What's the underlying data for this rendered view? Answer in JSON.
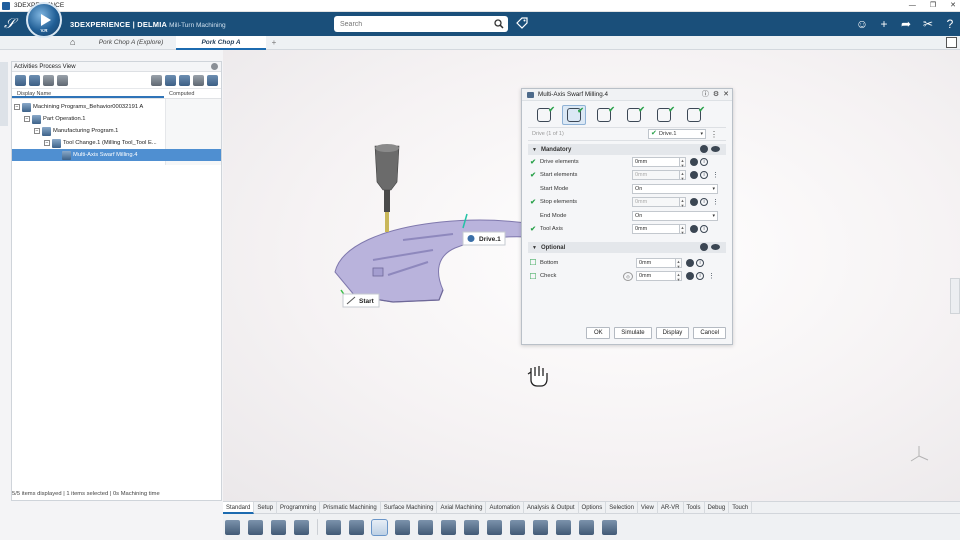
{
  "window": {
    "title": "3DEXPERIENCE",
    "controls": [
      "—",
      "❐",
      "✕"
    ]
  },
  "header": {
    "brand": "3DEXPERIENCE | DELMIA",
    "app": "Mill-Turn Machining",
    "compass_version": "V.R",
    "search_placeholder": "Search",
    "icons": [
      "user-icon",
      "add-icon",
      "share-icon",
      "tools-icon",
      "help-icon"
    ]
  },
  "tabs": [
    {
      "label": "Pork Chop A (Explore)",
      "active": false
    },
    {
      "label": "Pork Chop A",
      "active": true
    }
  ],
  "panel": {
    "title": "Activities Process View",
    "columns": [
      "Display Name",
      "Computed"
    ],
    "tree": [
      {
        "label": "Machining Programs_Behavior00032191 A",
        "level": 0
      },
      {
        "label": "Part Operation.1",
        "level": 1
      },
      {
        "label": "Manufacturing Program.1",
        "level": 2
      },
      {
        "label": "Tool Change.1 (Milling Tool_Tool E...",
        "level": 3
      },
      {
        "label": "Multi-Axis Swarf Milling.4",
        "level": 4,
        "selected": true
      }
    ],
    "status": "5/5 items displayed | 1 items selected | 0s Machining time"
  },
  "viewport": {
    "labels": {
      "drive": "Drive.1",
      "start": "Start"
    }
  },
  "dialog": {
    "title": "Multi-Axis Swarf Milling.4",
    "selector": {
      "label": "Drive (1 of 1)",
      "value": "Drive.1"
    },
    "mandatory": {
      "title": "Mandatory",
      "rows": [
        {
          "label": "Drive elements",
          "value": "0mm",
          "status": "ok",
          "disabled": false
        },
        {
          "label": "Start elements",
          "value": "0mm",
          "status": "ok",
          "disabled": true
        },
        {
          "label": "Start Mode",
          "value": "On",
          "type": "select"
        },
        {
          "label": "Stop elements",
          "value": "0mm",
          "status": "ok",
          "disabled": true
        },
        {
          "label": "End Mode",
          "value": "On",
          "type": "select"
        },
        {
          "label": "Tool Axis",
          "value": "0mm",
          "status": "ok",
          "disabled": false
        }
      ]
    },
    "optional": {
      "title": "Optional",
      "rows": [
        {
          "label": "Bottom",
          "value": "0mm"
        },
        {
          "label": "Check",
          "value": "0mm"
        }
      ]
    },
    "buttons": {
      "ok": "OK",
      "simulate": "Simulate",
      "display": "Display",
      "cancel": "Cancel"
    }
  },
  "actionbar": {
    "tabs": [
      "Standard",
      "Setup",
      "Programming",
      "Prismatic Machining",
      "Surface Machining",
      "Axial Machining",
      "Automation",
      "Analysis & Output",
      "Options",
      "Selection",
      "View",
      "AR-VR",
      "Tools",
      "Debug",
      "Touch"
    ],
    "active_tab": "Standard"
  },
  "colors": {
    "header": "#1a4f7a",
    "selection": "#4f8fd1",
    "part": "#b9b3dc",
    "check": "#2aa14a"
  }
}
